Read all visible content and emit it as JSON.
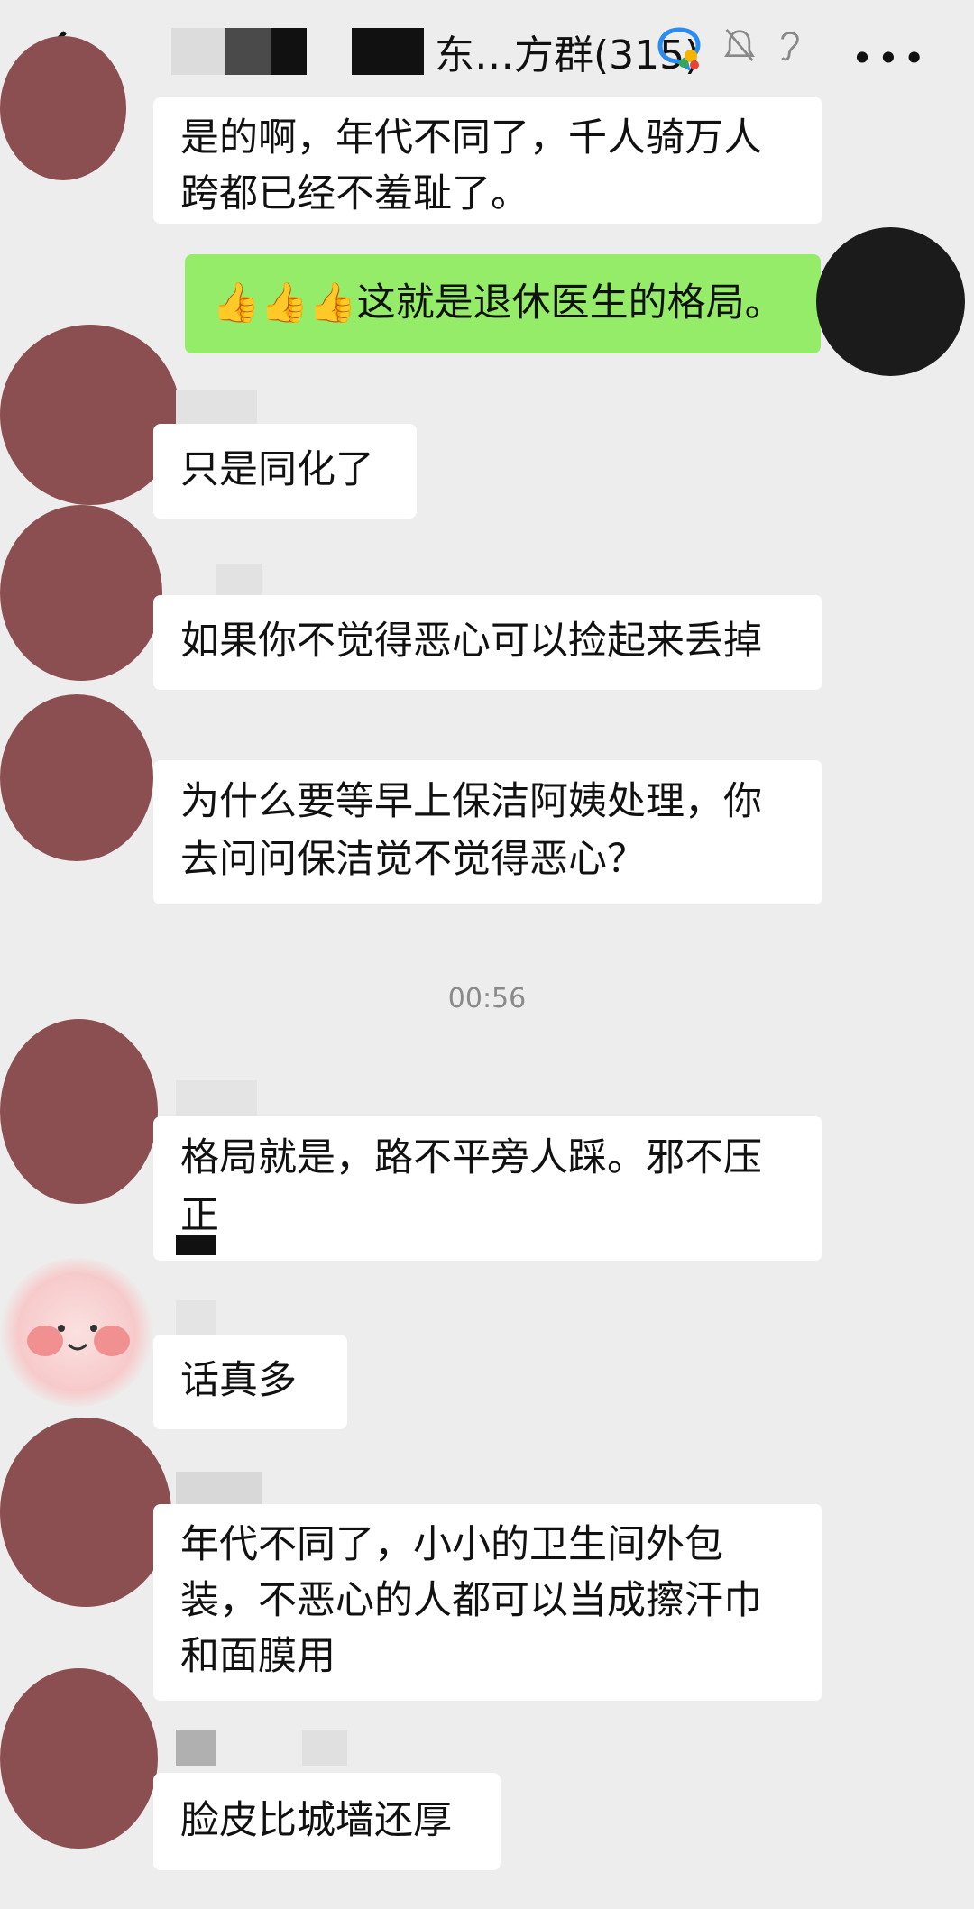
{
  "header": {
    "title": "东…方群(315)",
    "back_icon": "chevron-left-icon",
    "icons": [
      "group-chat-icon",
      "bell-muted-icon",
      "earpiece-icon",
      "more-icon"
    ],
    "more_label": "•••"
  },
  "messages": [
    {
      "sender": "other",
      "text": "是的啊，年代不同了，千人骑万人\n跨都已经不羞耻了。"
    },
    {
      "sender": "self",
      "text": "👍👍👍这就是退休医生的格局。"
    },
    {
      "sender": "other",
      "text": "只是同化了"
    },
    {
      "sender": "other",
      "text": "如果你不觉得恶心可以捡起来丢掉"
    },
    {
      "sender": "other",
      "text": "为什么要等早上保洁阿姨处理，你\n去问问保洁觉不觉得恶心？"
    },
    {
      "sender": "other",
      "text": "格局就是，路不平旁人踩。邪不压\n正"
    },
    {
      "sender": "other",
      "text": "话真多"
    },
    {
      "sender": "other",
      "text": "年代不同了，小小的卫生间外包\n装，不恶心的人都可以当成擦汗巾\n和面膜用"
    },
    {
      "sender": "other",
      "text": "脸皮比城墙还厚"
    }
  ],
  "timestamp": "00:56",
  "colors": {
    "background": "#ededed",
    "bubble_other": "#ffffff",
    "bubble_self": "#95ec69",
    "avatar_placeholder": "#8b4f52"
  }
}
